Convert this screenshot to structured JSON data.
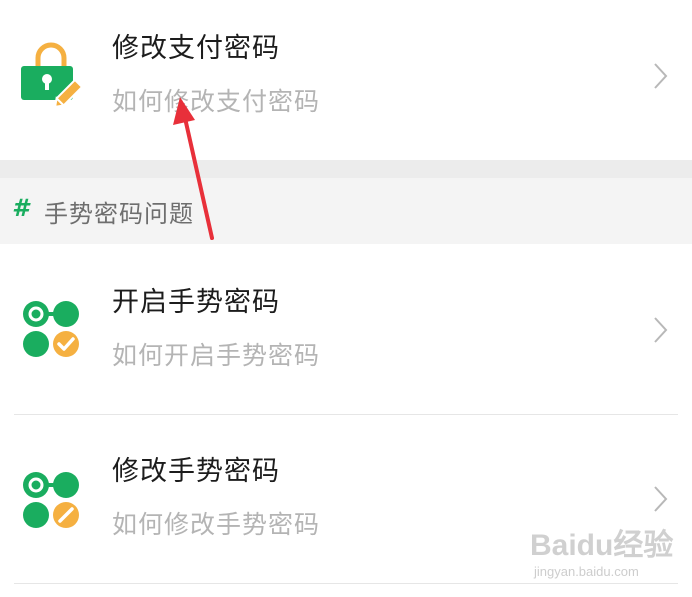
{
  "items": [
    {
      "title": "修改支付密码",
      "subtitle": "如何修改支付密码",
      "icon": "lock-edit-icon"
    },
    {
      "title": "开启手势密码",
      "subtitle": "如何开启手势密码",
      "icon": "gesture-check-icon"
    },
    {
      "title": "修改手势密码",
      "subtitle": "如何修改手势密码",
      "icon": "gesture-edit-icon"
    }
  ],
  "section": {
    "marker": "#",
    "label": "手势密码问题"
  },
  "watermark": {
    "brand": "Baidu经验",
    "url": "jingyan.baidu.com"
  },
  "colors": {
    "green": "#1aad5f",
    "orange": "#f5b041",
    "arrow": "#e8303a",
    "subtitle": "#b4b4b4"
  }
}
